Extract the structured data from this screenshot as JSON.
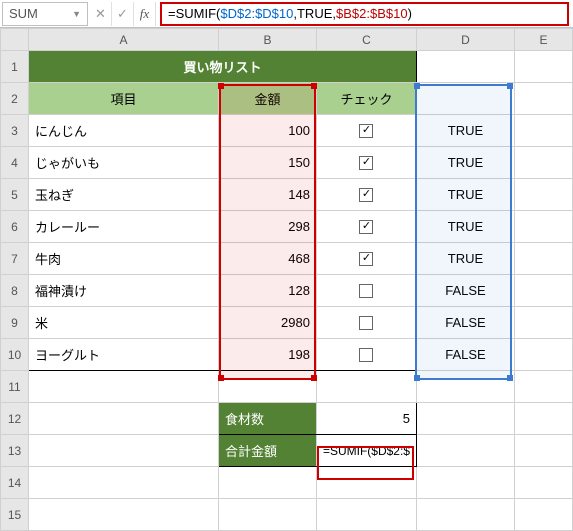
{
  "formula_bar": {
    "name_box": "SUM",
    "formula_prefix": "=SUMIF(",
    "range1": "$D$2:$D$10",
    "sep1": ",TRUE,",
    "range2": "$B$2:$B$10",
    "suffix": ")"
  },
  "columns": [
    "A",
    "B",
    "C",
    "D",
    "E"
  ],
  "title": "買い物リスト",
  "headers": {
    "item": "項目",
    "amount": "金額",
    "check": "チェック"
  },
  "rows": [
    {
      "item": "にんじん",
      "amount": "100",
      "checked": true,
      "flag": "TRUE"
    },
    {
      "item": "じゃがいも",
      "amount": "150",
      "checked": true,
      "flag": "TRUE"
    },
    {
      "item": "玉ねぎ",
      "amount": "148",
      "checked": true,
      "flag": "TRUE"
    },
    {
      "item": "カレールー",
      "amount": "298",
      "checked": true,
      "flag": "TRUE"
    },
    {
      "item": "牛肉",
      "amount": "468",
      "checked": true,
      "flag": "TRUE"
    },
    {
      "item": "福神漬け",
      "amount": "128",
      "checked": false,
      "flag": "FALSE"
    },
    {
      "item": "米",
      "amount": "2980",
      "checked": false,
      "flag": "FALSE"
    },
    {
      "item": "ヨーグルト",
      "amount": "198",
      "checked": false,
      "flag": "FALSE"
    }
  ],
  "summary": {
    "count_label": "食材数",
    "count_value": "5",
    "total_label": "合計金額",
    "total_formula": "=SUMIF($D$2:$"
  },
  "chart_data": {
    "type": "table",
    "title": "買い物リスト",
    "columns": [
      "項目",
      "金額",
      "チェック",
      "D"
    ],
    "rows": [
      [
        "にんじん",
        100,
        true,
        "TRUE"
      ],
      [
        "じゃがいも",
        150,
        true,
        "TRUE"
      ],
      [
        "玉ねぎ",
        148,
        true,
        "TRUE"
      ],
      [
        "カレールー",
        298,
        true,
        "TRUE"
      ],
      [
        "牛肉",
        468,
        true,
        "TRUE"
      ],
      [
        "福神漬け",
        128,
        false,
        "FALSE"
      ],
      [
        "米",
        2980,
        false,
        "FALSE"
      ],
      [
        "ヨーグルト",
        198,
        false,
        "FALSE"
      ]
    ],
    "summary": {
      "食材数": 5,
      "合計金額_formula": "=SUMIF($D$2:$D$10,TRUE,$B$2:$B$10)"
    }
  }
}
